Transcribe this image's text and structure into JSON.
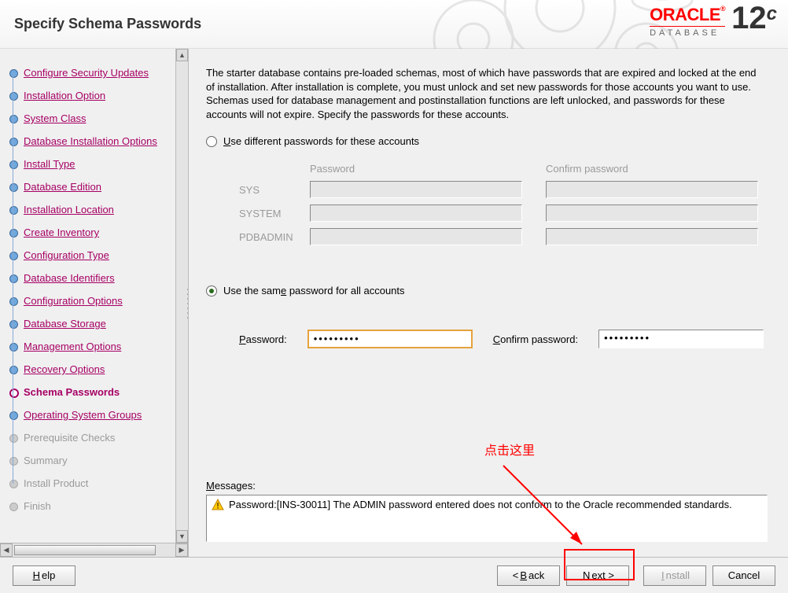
{
  "header": {
    "title": "Specify Schema Passwords",
    "brand_oracle": "ORACLE",
    "brand_db": "DATABASE",
    "brand_12": "12",
    "brand_c": "c"
  },
  "sidebar": {
    "items": [
      {
        "label": "Configure Security Updates",
        "state": "done"
      },
      {
        "label": "Installation Option",
        "state": "done"
      },
      {
        "label": "System Class",
        "state": "done"
      },
      {
        "label": "Database Installation Options",
        "state": "done"
      },
      {
        "label": "Install Type",
        "state": "done"
      },
      {
        "label": "Database Edition",
        "state": "done"
      },
      {
        "label": "Installation Location",
        "state": "done"
      },
      {
        "label": "Create Inventory",
        "state": "done"
      },
      {
        "label": "Configuration Type",
        "state": "done"
      },
      {
        "label": "Database Identifiers",
        "state": "done"
      },
      {
        "label": "Configuration Options",
        "state": "done"
      },
      {
        "label": "Database Storage",
        "state": "done"
      },
      {
        "label": "Management Options",
        "state": "done"
      },
      {
        "label": "Recovery Options",
        "state": "done"
      },
      {
        "label": "Schema Passwords",
        "state": "current"
      },
      {
        "label": "Operating System Groups",
        "state": "done"
      },
      {
        "label": "Prerequisite Checks",
        "state": "disabled"
      },
      {
        "label": "Summary",
        "state": "disabled"
      },
      {
        "label": "Install Product",
        "state": "disabled"
      },
      {
        "label": "Finish",
        "state": "disabled"
      }
    ]
  },
  "content": {
    "intro": "The starter database contains pre-loaded schemas, most of which have passwords that are expired and locked at the end of installation. After installation is complete, you must unlock and set new passwords for those accounts you want to use. Schemas used for database management and postinstallation functions are left unlocked, and passwords for these accounts will not expire. Specify the passwords for these accounts.",
    "radio_diff_pre": "U",
    "radio_diff_post": "se different passwords for these accounts",
    "table": {
      "col_password": "Password",
      "col_confirm": "Confirm password",
      "rows": [
        {
          "name_pre": "S",
          "name_post": "YS"
        },
        {
          "name_pre": "S",
          "name_post": "YSTEM"
        },
        {
          "name_pre": "P",
          "name_post": "DBADMIN"
        }
      ]
    },
    "radio_same_pre": "Use the sam",
    "radio_same_mid": "e",
    "radio_same_post": " password for all accounts",
    "password_label_pre": "P",
    "password_label_post": "assword:",
    "confirm_label_pre": "C",
    "confirm_label_post": "onfirm password:",
    "password_value": "•••••••••",
    "confirm_value": "•••••••••",
    "messages_label_pre": "M",
    "messages_label_post": "essages:",
    "message_text": "Password:[INS-30011] The ADMIN password entered does not conform to the Oracle recommended standards."
  },
  "footer": {
    "help_pre": "H",
    "help_post": "elp",
    "back_pre": "< ",
    "back_ul": "B",
    "back_post": "ack",
    "next_pre": "",
    "next_ul": "N",
    "next_post": "ext >",
    "install_pre": "",
    "install_ul": "I",
    "install_post": "nstall",
    "cancel": "Cancel"
  },
  "annotation": {
    "text": "点击这里"
  }
}
